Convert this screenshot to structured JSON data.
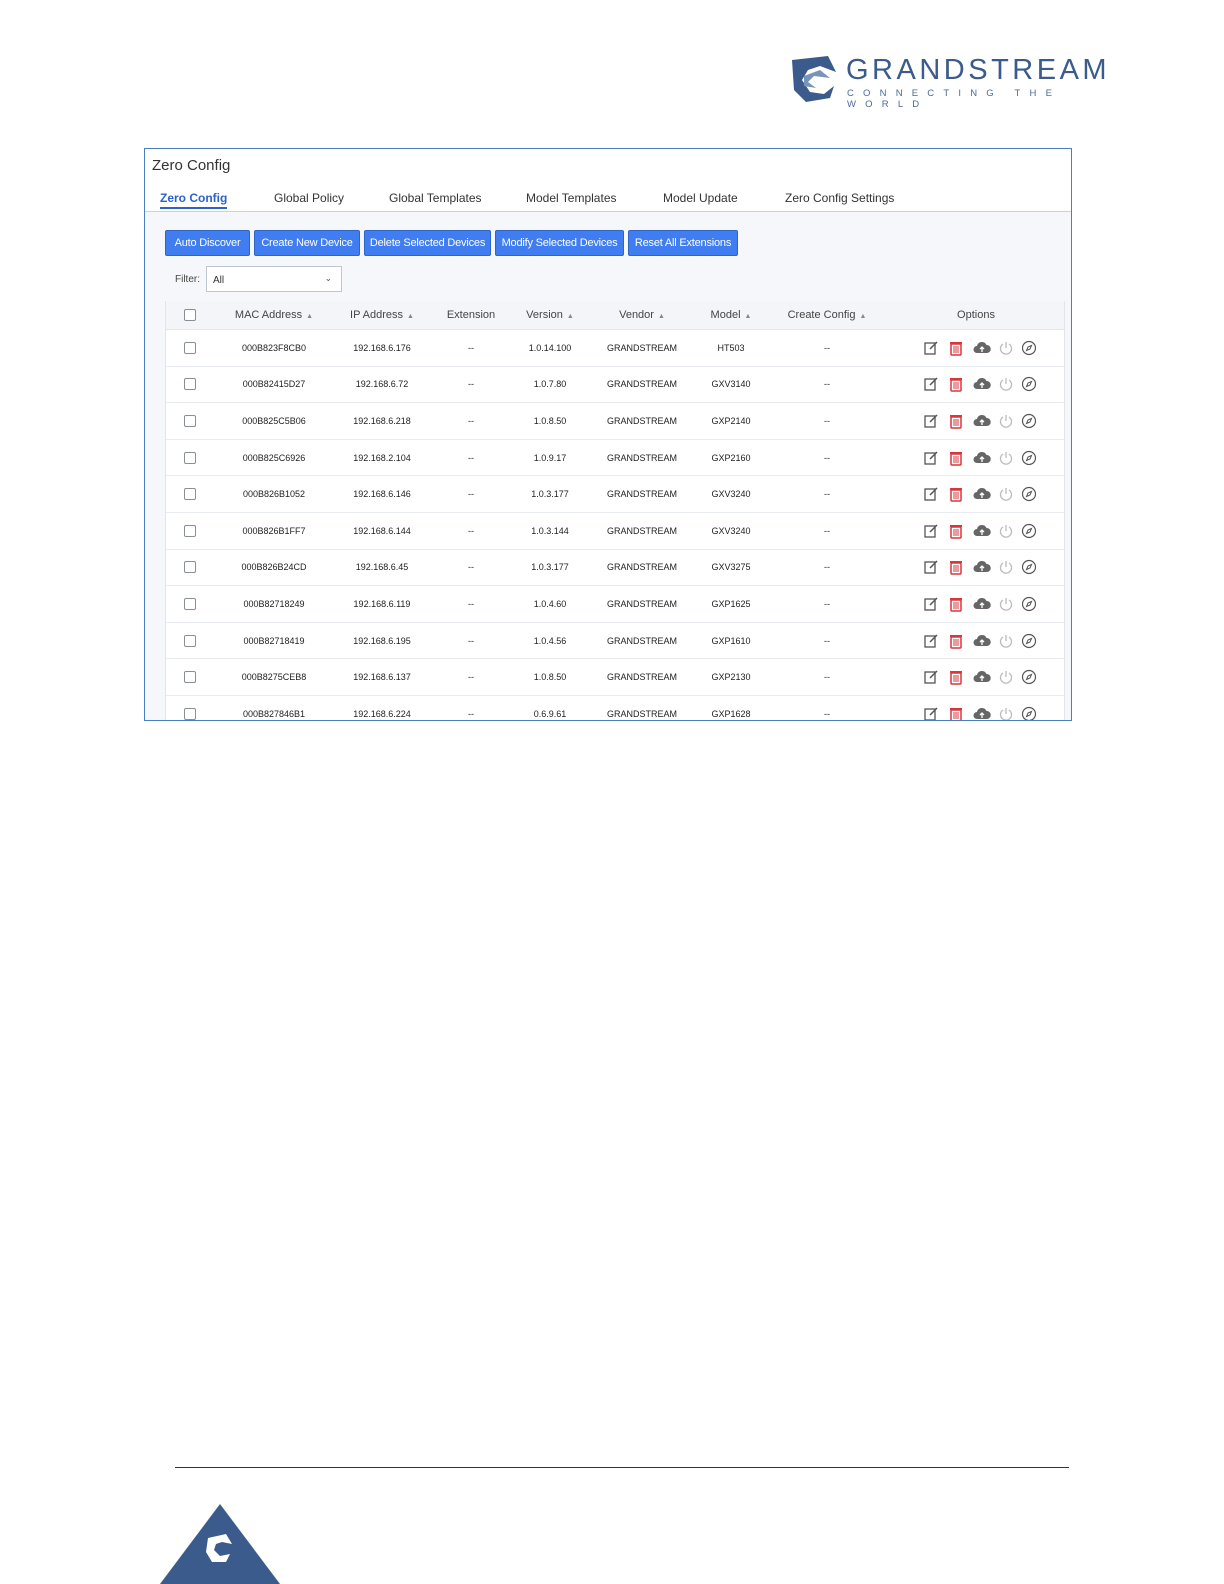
{
  "logo": {
    "brand": "GRANDSTREAM",
    "tagline": "CONNECTING THE WORLD"
  },
  "panel": {
    "title": "Zero Config",
    "tabs": [
      "Zero Config",
      "Global Policy",
      "Global Templates",
      "Model Templates",
      "Model Update",
      "Zero Config Settings"
    ],
    "active_tab": "Zero Config",
    "buttons": [
      "Auto Discover",
      "Create New Device",
      "Delete Selected Devices",
      "Modify Selected Devices",
      "Reset All Extensions"
    ],
    "filter": {
      "label": "Filter:",
      "value": "All"
    }
  },
  "table": {
    "columns": [
      "MAC Address",
      "IP Address",
      "Extension",
      "Version",
      "Vendor",
      "Model",
      "Create Config",
      "Options"
    ],
    "rows": [
      [
        "000B823F8CB0",
        "192.168.6.176",
        "--",
        "1.0.14.100",
        "GRANDSTREAM",
        "HT503",
        "--"
      ],
      [
        "000B82415D27",
        "192.168.6.72",
        "--",
        "1.0.7.80",
        "GRANDSTREAM",
        "GXV3140",
        "--"
      ],
      [
        "000B825C5B06",
        "192.168.6.218",
        "--",
        "1.0.8.50",
        "GRANDSTREAM",
        "GXP2140",
        "--"
      ],
      [
        "000B825C6926",
        "192.168.2.104",
        "--",
        "1.0.9.17",
        "GRANDSTREAM",
        "GXP2160",
        "--"
      ],
      [
        "000B826B1052",
        "192.168.6.146",
        "--",
        "1.0.3.177",
        "GRANDSTREAM",
        "GXV3240",
        "--"
      ],
      [
        "000B826B1FF7",
        "192.168.6.144",
        "--",
        "1.0.3.144",
        "GRANDSTREAM",
        "GXV3240",
        "--"
      ],
      [
        "000B826B24CD",
        "192.168.6.45",
        "--",
        "1.0.3.177",
        "GRANDSTREAM",
        "GXV3275",
        "--"
      ],
      [
        "000B82718249",
        "192.168.6.119",
        "--",
        "1.0.4.60",
        "GRANDSTREAM",
        "GXP1625",
        "--"
      ],
      [
        "000B82718419",
        "192.168.6.195",
        "--",
        "1.0.4.56",
        "GRANDSTREAM",
        "GXP1610",
        "--"
      ],
      [
        "000B8275CEB8",
        "192.168.6.137",
        "--",
        "1.0.8.50",
        "GRANDSTREAM",
        "GXP2130",
        "--"
      ],
      [
        "000B827846B1",
        "192.168.6.224",
        "--",
        "0.6.9.61",
        "GRANDSTREAM",
        "GXP1628",
        "--"
      ]
    ],
    "option_icons": [
      "edit-icon",
      "delete-icon",
      "upload-cloud-icon",
      "power-icon",
      "compass-icon"
    ]
  },
  "colors": {
    "accent": "#3f7df0",
    "brand": "#3b5b8c",
    "delete": "#d9363e",
    "panel_border": "#4a7fc0"
  }
}
